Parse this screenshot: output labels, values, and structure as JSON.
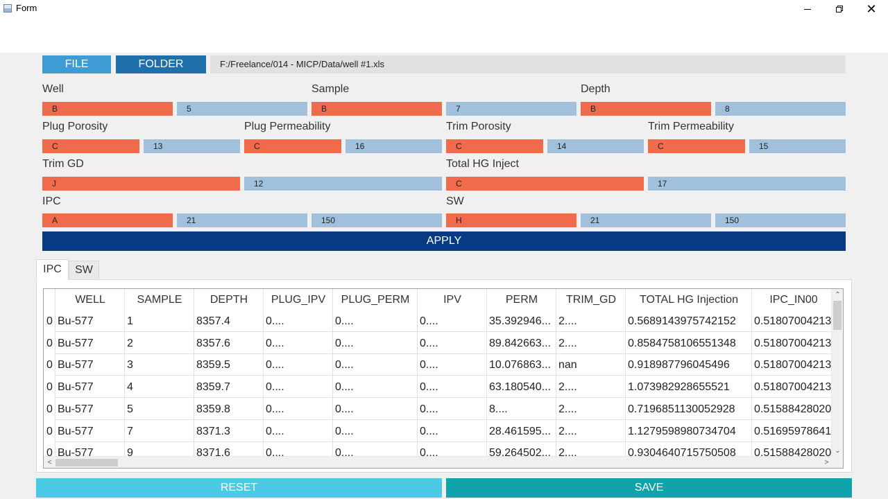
{
  "window": {
    "title": "Form",
    "minimize": "—",
    "close": "✕"
  },
  "toolbar": {
    "file_label": "FILE",
    "folder_label": "FOLDER",
    "path": "F:/Freelance/014 - MICP/Data/well #1.xls"
  },
  "mapping": {
    "well": {
      "label": "Well",
      "col": "B",
      "row": "5"
    },
    "sample": {
      "label": "Sample",
      "col": "B",
      "row": "7"
    },
    "depth": {
      "label": "Depth",
      "col": "B",
      "row": "8"
    },
    "plug_porosity": {
      "label": "Plug Porosity",
      "col": "C",
      "row": "13"
    },
    "plug_permeability": {
      "label": "Plug Permeability",
      "col": "C",
      "row": "16"
    },
    "trim_porosity": {
      "label": "Trim Porosity",
      "col": "C",
      "row": "14"
    },
    "trim_permeability": {
      "label": "Trim Permeability",
      "col": "C",
      "row": "15"
    },
    "trim_gd": {
      "label": "Trim GD",
      "col": "J",
      "row": "12"
    },
    "total_hg_inject": {
      "label": "Total HG Inject",
      "col": "C",
      "row": "17"
    },
    "ipc": {
      "label": "IPC",
      "col": "A",
      "row_start": "21",
      "row_end": "150"
    },
    "sw": {
      "label": "SW",
      "col": "H",
      "row_start": "21",
      "row_end": "150"
    }
  },
  "apply_label": "APPLY",
  "tabs": [
    {
      "label": "IPC",
      "active": true
    },
    {
      "label": "SW",
      "active": false
    }
  ],
  "table": {
    "columns": [
      "WELL",
      "SAMPLE",
      "DEPTH",
      "PLUG_IPV",
      "PLUG_PERM",
      "IPV",
      "PERM",
      "TRIM_GD",
      "TOTAL HG Injection",
      "IPC_IN00"
    ],
    "rows": [
      {
        "idx": "0",
        "cells": [
          "Bu-577",
          "1",
          "8357.4",
          "0....",
          "0....",
          "0....",
          "35.392946...",
          "2....",
          "0.5689143975742152",
          "0.51807004213"
        ]
      },
      {
        "idx": "0",
        "cells": [
          "Bu-577",
          "2",
          "8357.6",
          "0....",
          "0....",
          "0....",
          "89.842663...",
          "2....",
          "0.8584758106551348",
          "0.51807004213"
        ]
      },
      {
        "idx": "0",
        "cells": [
          "Bu-577",
          "3",
          "8359.5",
          "0....",
          "0....",
          "0....",
          "10.076863...",
          "nan",
          "0.918987796045496",
          "0.51807004213"
        ]
      },
      {
        "idx": "0",
        "cells": [
          "Bu-577",
          "4",
          "8359.7",
          "0....",
          "0....",
          "0....",
          "63.180540...",
          "2....",
          "1.073982928655521",
          "0.51807004213"
        ]
      },
      {
        "idx": "0",
        "cells": [
          "Bu-577",
          "5",
          "8359.8",
          "0....",
          "0....",
          "0....",
          "8....",
          "2....",
          "0.7196851130052928",
          "0.51588428020"
        ]
      },
      {
        "idx": "0",
        "cells": [
          "Bu-577",
          "7",
          "8371.3",
          "0....",
          "0....",
          "0....",
          "28.461595...",
          "2....",
          "1.1279598980734704",
          "0.51695978641"
        ]
      },
      {
        "idx": "0",
        "cells": [
          "Bu-577",
          "9",
          "8371.6",
          "0....",
          "0....",
          "0....",
          "59.264502...",
          "2....",
          "0.9304640715750508",
          "0.51588428020"
        ]
      }
    ]
  },
  "reset_label": "RESET",
  "save_label": "SAVE"
}
